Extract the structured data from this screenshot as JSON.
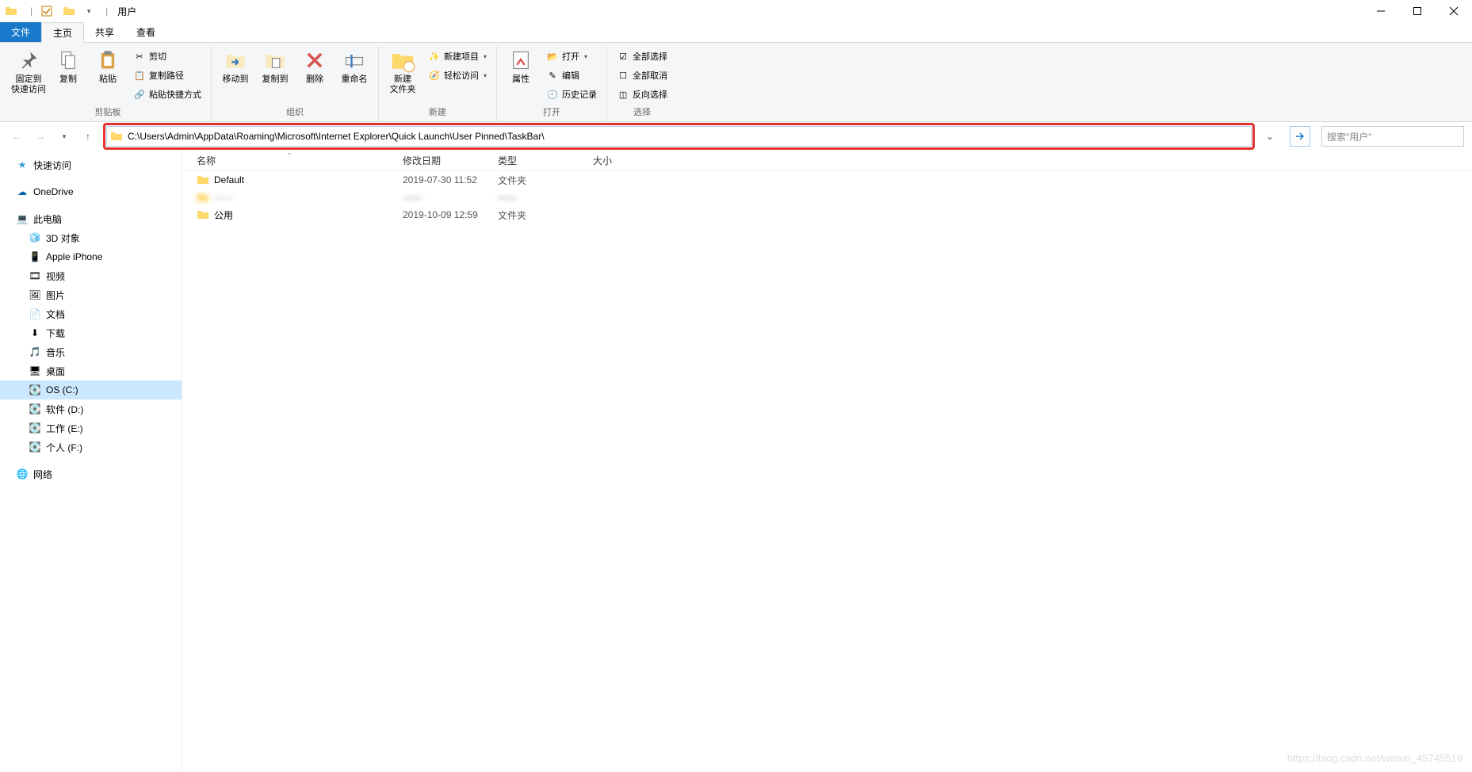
{
  "window": {
    "title": "用户"
  },
  "tabs": {
    "file": "文件",
    "home": "主页",
    "share": "共享",
    "view": "查看"
  },
  "ribbon": {
    "clipboard": {
      "pin": "固定到\n快速访问",
      "copy": "复制",
      "paste": "粘贴",
      "cut": "剪切",
      "copypath": "复制路径",
      "pasteshortcut": "粘贴快捷方式",
      "label": "剪贴板"
    },
    "organize": {
      "moveto": "移动到",
      "copyto": "复制到",
      "delete": "删除",
      "rename": "重命名",
      "label": "组织"
    },
    "new": {
      "newfolder": "新建\n文件夹",
      "newitem": "新建项目",
      "easyaccess": "轻松访问",
      "label": "新建"
    },
    "open": {
      "properties": "属性",
      "open": "打开",
      "edit": "编辑",
      "history": "历史记录",
      "label": "打开"
    },
    "select": {
      "selectall": "全部选择",
      "selectnone": "全部取消",
      "invert": "反向选择",
      "label": "选择"
    }
  },
  "address": {
    "path": "C:\\Users\\Admin\\AppData\\Roaming\\Microsoft\\Internet Explorer\\Quick Launch\\User Pinned\\TaskBar\\",
    "search_placeholder": "搜索\"用户\""
  },
  "columns": {
    "name": "名称",
    "date": "修改日期",
    "type": "类型",
    "size": "大小"
  },
  "rows": [
    {
      "name": "Default",
      "date": "2019-07-30 11:52",
      "type": "文件夹",
      "blurred": false
    },
    {
      "name": "——",
      "date": "——",
      "type": "——",
      "blurred": true
    },
    {
      "name": "公用",
      "date": "2019-10-09 12:59",
      "type": "文件夹",
      "blurred": false
    }
  ],
  "nav": {
    "quick": "快速访问",
    "onedrive": "OneDrive",
    "thispc": "此电脑",
    "items": [
      "3D 对象",
      "Apple iPhone",
      "视频",
      "图片",
      "文档",
      "下载",
      "音乐",
      "桌面",
      "OS (C:)",
      "软件 (D:)",
      "工作 (E:)",
      "个人 (F:)"
    ],
    "network": "网络"
  },
  "watermark": "https://blog.csdn.net/weixin_45745519"
}
